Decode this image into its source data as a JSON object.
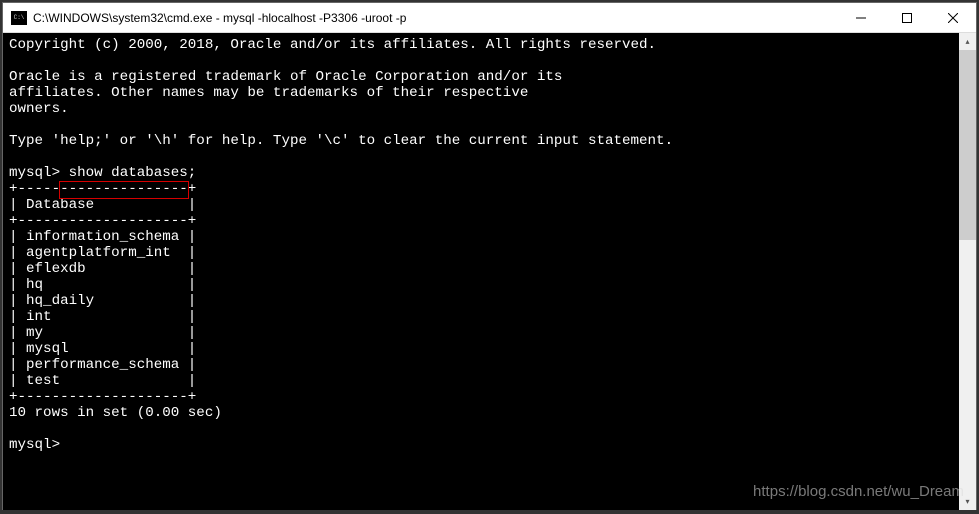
{
  "window": {
    "title": "C:\\WINDOWS\\system32\\cmd.exe - mysql  -hlocalhost -P3306 -uroot -p"
  },
  "terminal": {
    "copyright": "Copyright (c) 2000, 2018, Oracle and/or its affiliates. All rights reserved.",
    "trademark1": "Oracle is a registered trademark of Oracle Corporation and/or its",
    "trademark2": "affiliates. Other names may be trademarks of their respective",
    "trademark3": "owners.",
    "help": "Type 'help;' or '\\h' for help. Type '\\c' to clear the current input statement.",
    "prompt1": "mysql>",
    "command1": " show databases;",
    "table_top": "+--------------------+",
    "table_header": "| Database           |",
    "table_sep": "+--------------------+",
    "row0": "| information_schema |",
    "row1": "| agentplatform_int  |",
    "row2": "| eflexdb            |",
    "row3": "| hq                 |",
    "row4": "| hq_daily           |",
    "row5": "| int                |",
    "row6": "| my                 |",
    "row7": "| mysql              |",
    "row8": "| performance_schema |",
    "row9": "| test               |",
    "table_bot": "+--------------------+",
    "result": "10 rows in set (0.00 sec)",
    "prompt2": "mysql>",
    "databases": [
      "information_schema",
      "agentplatform_int",
      "eflexdb",
      "hq",
      "hq_daily",
      "int",
      "my",
      "mysql",
      "performance_schema",
      "test"
    ]
  },
  "watermark": "https://blog.csdn.net/wu_Dream"
}
